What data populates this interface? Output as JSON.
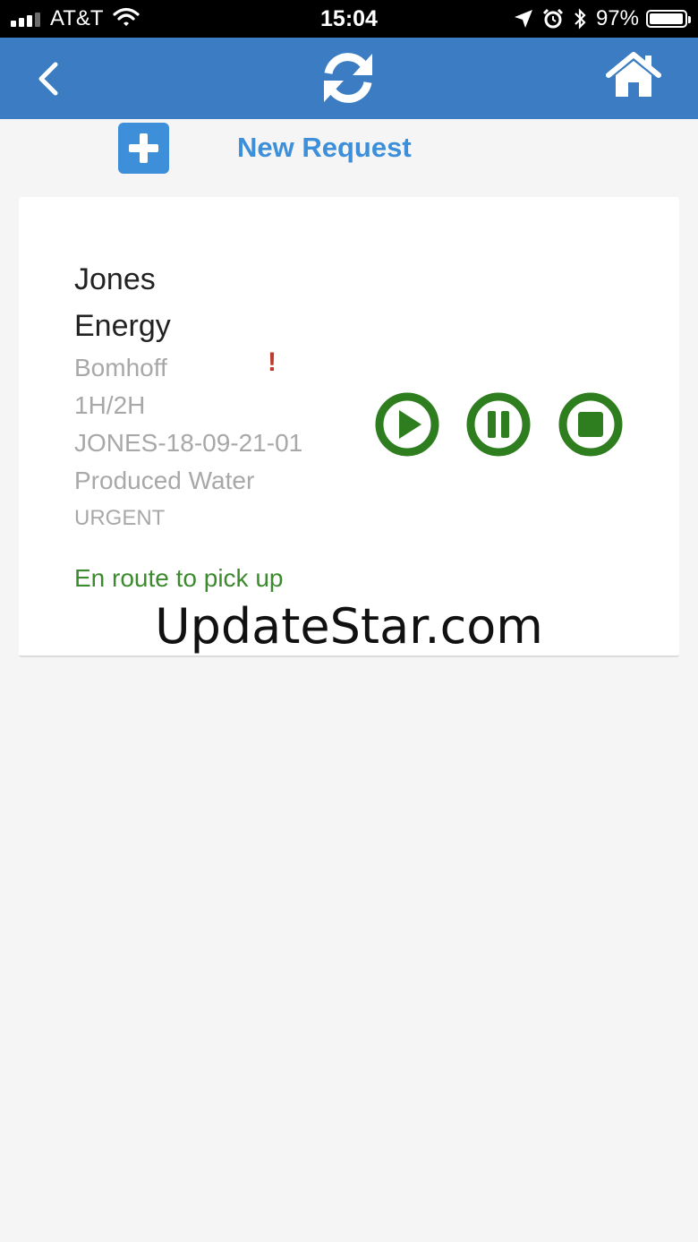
{
  "status_bar": {
    "carrier": "AT&T",
    "time": "15:04",
    "battery": "97%",
    "battery_level": 0.97
  },
  "new_request": {
    "label": "New Request"
  },
  "job": {
    "company": "Jones Energy",
    "lease": "Bomhoff",
    "alert": "!",
    "well": "1H/2H",
    "ticket": "JONES-18-09-21-01",
    "product": "Produced Water",
    "priority": "URGENT",
    "status": "En route to pick up"
  },
  "watermark": "UpdateStar.com",
  "colors": {
    "nav_blue": "#3b7cc2",
    "accent_blue": "#3d8fd9",
    "control_green": "#2e7d1f",
    "status_green": "#3c8a2e",
    "alert_red": "#c0392b"
  },
  "icons": {
    "back": "chevron-left-icon",
    "refresh": "refresh-icon",
    "home": "home-icon",
    "add": "plus-icon",
    "play": "play-icon",
    "pause": "pause-icon",
    "stop": "stop-icon"
  }
}
